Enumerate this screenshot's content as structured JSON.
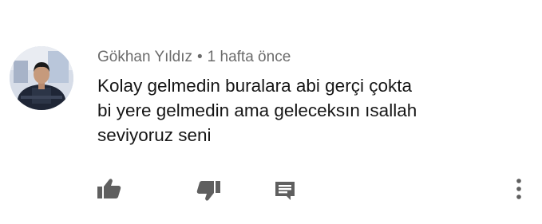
{
  "comment": {
    "author": "Gökhan Yıldız",
    "separator": "•",
    "time": "1 hafta önce",
    "text_lines": [
      "Kolay gelmedin buralara abi gerçi çokta",
      "bi yere gelmedin ama geleceksın ısallah",
      "seviyoruz seni"
    ]
  },
  "icons": {
    "like": "thumbs-up-icon",
    "dislike": "thumbs-down-icon",
    "reply": "reply-comment-icon",
    "more": "more-vertical-icon"
  },
  "colors": {
    "meta_text": "#6b6b6b",
    "body_text": "#161616",
    "icon": "#5f5f5f"
  }
}
